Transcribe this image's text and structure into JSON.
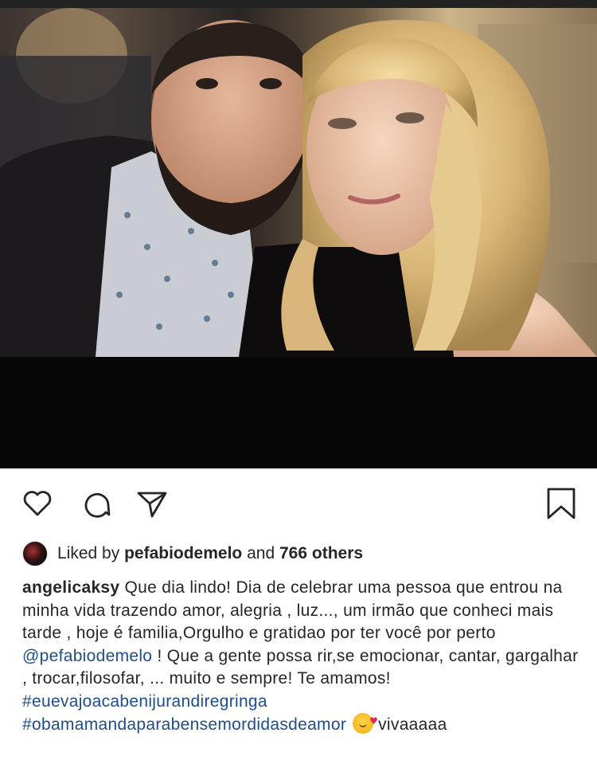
{
  "post": {
    "liked_by_prefix": "Liked by",
    "liked_by_user": "pefabiodemelo",
    "liked_by_and": "and",
    "liked_by_others": "766 others",
    "caption_user": "angelicaksy",
    "caption_text_1": "Que dia lindo! Dia de celebrar uma pessoa que entrou na minha vida trazendo amor, alegria , luz..., um irmão que  conheci mais tarde , hoje é familia,Orgulho e gratidao por ter você por perto",
    "caption_mention": "@pefabiodemelo",
    "caption_text_2": "! Que a gente possa rir,se emocionar, cantar, gargalhar , trocar,filosofar, ... muito e  sempre! Te amamos!",
    "hashtag_1": "#euevajoacabenijurandiregringa",
    "hashtag_2": "#obamamandaparabensemordidasdeamor",
    "caption_end": "vivaaaaa",
    "emoji": "smiling-face-with-hearts"
  },
  "actions": {
    "like_icon": "heart-icon",
    "comment_icon": "comment-icon",
    "share_icon": "send-icon",
    "save_icon": "bookmark-icon"
  },
  "colors": {
    "link": "#1d4e8c",
    "text": "#262626"
  }
}
